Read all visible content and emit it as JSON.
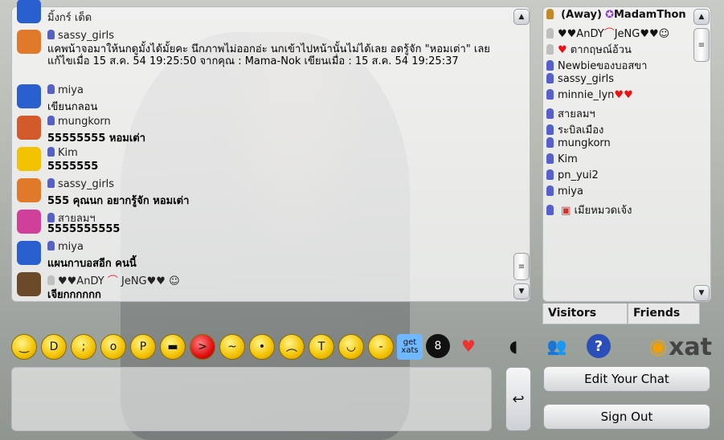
{
  "chat": {
    "top_partial": "มิ้งกร์ เด็ด",
    "messages": [
      {
        "user": "sassy_girls",
        "text": "แคพน้าจอมาให้นกดูมั้งได้มั้ยคะ นึกภาพไม่ออกอ่ะ นกเข้าไปหน้านั้นไม่ได้เลย อดรู้จัก \"หอมเต่า\" เลย แก้ไขเมื่อ 15 ส.ค. 54 19:25:50 จากคุณ : Mama-Nok    เขียนเมื่อ : 15 ส.ค. 54 19:25:37",
        "avatar_color": "#e07a2a"
      },
      {
        "user": "miya",
        "text": "เขียนกลอน",
        "avatar_color": "#2a5fd0"
      },
      {
        "user": "mungkorn",
        "text": "55555555  หอมเต่า",
        "avatar_color": "#d35a2a"
      },
      {
        "user": "Kim",
        "text": "5555555",
        "avatar_color": "#f2c200"
      },
      {
        "user": "sassy_girls",
        "text": "555  คุณนก อยากรู้จัก หอมเต่า",
        "avatar_color": "#e07a2a"
      },
      {
        "user": "สายลมฯ",
        "text": "5555555555",
        "avatar_color": "#d0409a"
      },
      {
        "user": "miya",
        "text": "แผนกาบอสอีก คนนี้",
        "avatar_color": "#2a5fd0"
      },
      {
        "user": "♥♥AnDY",
        "user_suffix": "JeNG♥♥",
        "text": "เจียกกกกกก",
        "avatar_color": "#6b4a2a"
      }
    ]
  },
  "users": {
    "list": [
      {
        "name": "(Away)",
        "extra": "MadamThon",
        "pin": "gold"
      },
      {
        "name": "♥♥AnDY",
        "extra": "JeNG♥♥",
        "pin": "grey"
      },
      {
        "name": "ตากฤษณ์อ้วน",
        "pin": "grey"
      },
      {
        "name": "Newbieของบอสขา",
        "pin": "blue"
      },
      {
        "name": "sassy_girls",
        "pin": "blue"
      },
      {
        "name": "minnie_lyn",
        "pin": "blue"
      },
      {
        "name": "สายลมฯ",
        "pin": "blue"
      },
      {
        "name": "ระบิลเมือง",
        "pin": "blue"
      },
      {
        "name": "mungkorn",
        "pin": "blue"
      },
      {
        "name": "Kim",
        "pin": "blue"
      },
      {
        "name": "pn_yui2",
        "pin": "blue"
      },
      {
        "name": "miya",
        "pin": "blue"
      },
      {
        "name": "เมียหมวดเจ้ง",
        "pin": "blue"
      }
    ],
    "tabs": {
      "visitors": "Visitors",
      "friends": "Friends"
    }
  },
  "smileys": [
    "smile",
    "biggrin",
    "wink",
    "eek",
    "tongue",
    "cool",
    "mad",
    "confused",
    "redface",
    "frown",
    "crying",
    "pleased",
    "think"
  ],
  "getxats": "get xats",
  "buttons": {
    "edit_chat": "Edit Your Chat",
    "sign_out": "Sign Out",
    "send_arrow": "↩"
  },
  "brand": "xat",
  "scroll_thumb": "≡"
}
